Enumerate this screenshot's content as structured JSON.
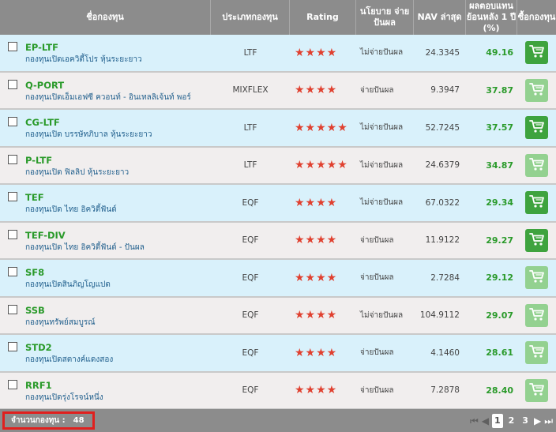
{
  "header": {
    "name": "ชื่อกองทุน",
    "type": "ประเภทกองทุน",
    "rating": "Rating",
    "dividend": "นโยบาย จ่ายปันผล",
    "nav": "NAV ล่าสุด",
    "return": "ผลตอบแทนย้อนหลัง 1 ปี (%)",
    "buy": "ซื้อกองทุน"
  },
  "funds": [
    {
      "code": "EP-LTF",
      "name": "กองทุนเปิดเอควิตี้โปร หุ้นระยะยาว",
      "type": "LTF",
      "stars": "★★★★",
      "rating": 4,
      "dividend": "ไม่จ่ายปันผล",
      "nav": "24.3345",
      "ret": "49.16",
      "buy_active": true,
      "bg": "blue"
    },
    {
      "code": "Q-PORT",
      "name": "กองทุนเปิดเอ็มเอฟซี ควอนท์ - อินเทลลิเจ้นท์ พอร์",
      "type": "MIXFLEX",
      "stars": "★★★★",
      "rating": 4,
      "dividend": "จ่ายปันผล",
      "nav": "9.3947",
      "ret": "37.87",
      "buy_active": false,
      "bg": "gray"
    },
    {
      "code": "CG-LTF",
      "name": "กองทุนเปิด บรรษัทภิบาล หุ้นระยะยาว",
      "type": "LTF",
      "stars": "★★★★★",
      "rating": 5,
      "dividend": "ไม่จ่ายปันผล",
      "nav": "52.7245",
      "ret": "37.57",
      "buy_active": true,
      "bg": "blue"
    },
    {
      "code": "P-LTF",
      "name": "กองทุนเปิด ฟิลลิป หุ้นระยะยาว",
      "type": "LTF",
      "stars": "★★★★★",
      "rating": 5,
      "dividend": "ไม่จ่ายปันผล",
      "nav": "24.6379",
      "ret": "34.87",
      "buy_active": false,
      "bg": "gray"
    },
    {
      "code": "TEF",
      "name": "กองทุนเปิด ไทย อิควิตี้ฟันด์",
      "type": "EQF",
      "stars": "★★★★",
      "rating": 4,
      "dividend": "ไม่จ่ายปันผล",
      "nav": "67.0322",
      "ret": "29.34",
      "buy_active": true,
      "bg": "blue"
    },
    {
      "code": "TEF-DIV",
      "name": "กองทุนเปิด ไทย อิควิตี้ฟันด์ - ปันผล",
      "type": "EQF",
      "stars": "★★★★",
      "rating": 4,
      "dividend": "จ่ายปันผล",
      "nav": "11.9122",
      "ret": "29.27",
      "buy_active": true,
      "bg": "gray"
    },
    {
      "code": "SF8",
      "name": "กองทุนเปิดสินภิญโญแปด",
      "type": "EQF",
      "stars": "★★★★",
      "rating": 4,
      "dividend": "จ่ายปันผล",
      "nav": "2.7284",
      "ret": "29.12",
      "buy_active": false,
      "bg": "blue"
    },
    {
      "code": "SSB",
      "name": "กองทุนทรัพย์สมบูรณ์",
      "type": "EQF",
      "stars": "★★★★",
      "rating": 4,
      "dividend": "ไม่จ่ายปันผล",
      "nav": "104.9112",
      "ret": "29.07",
      "buy_active": false,
      "bg": "gray"
    },
    {
      "code": "STD2",
      "name": "กองทุนเปิดสตางค์แดงสอง",
      "type": "EQF",
      "stars": "★★★★",
      "rating": 4,
      "dividend": "จ่ายปันผล",
      "nav": "4.1460",
      "ret": "28.61",
      "buy_active": false,
      "bg": "blue"
    },
    {
      "code": "RRF1",
      "name": "กองทุนเปิดรุ่งโรจน์หนึ่ง",
      "type": "EQF",
      "stars": "★★★★",
      "rating": 4,
      "dividend": "จ่ายปันผล",
      "nav": "7.2878",
      "ret": "28.40",
      "buy_active": false,
      "bg": "gray"
    }
  ],
  "footer": {
    "count_label": "จำนวนกองทุน :",
    "count_value": "48",
    "pages": [
      "1",
      "2",
      "3"
    ],
    "current_page": "1"
  },
  "colors": {
    "header_bg": "#8c8c8c",
    "row_blue": "#d9f1fb",
    "row_gray": "#f1eeee",
    "fund_code": "#2a9a2a",
    "star": "#e0402f",
    "buy_active": "#3ea33e",
    "buy_inactive": "#93d190",
    "highlight_box": "#e0201e"
  }
}
